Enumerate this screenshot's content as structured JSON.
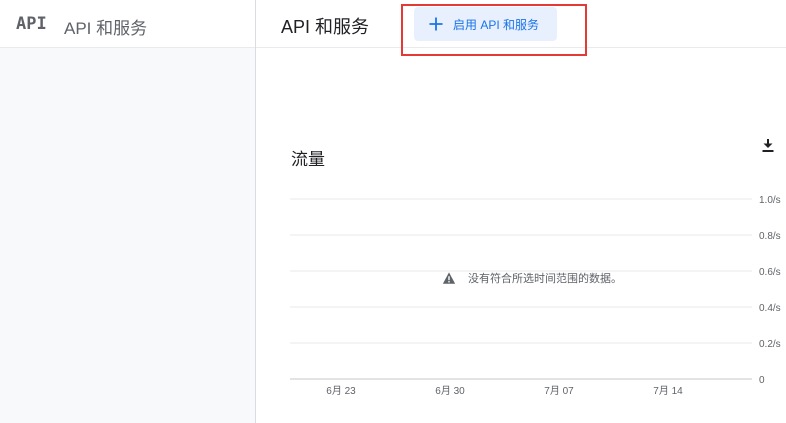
{
  "sidebar": {
    "logo_text": "API",
    "title": "API 和服务"
  },
  "header": {
    "page_title": "API 和服务",
    "enable_button_label": "启用 API 和服务"
  },
  "traffic": {
    "title": "流量",
    "no_data_message": "没有符合所选时间范围的数据。",
    "icons": {
      "download": "download-icon",
      "warning": "warning-icon"
    }
  },
  "colors": {
    "accent": "#1a73e8",
    "button_bg": "#e8f0fe",
    "highlight": "#e53935",
    "grid": "#e8eaed"
  },
  "chart_data": {
    "type": "line",
    "title": "流量",
    "x_tick_labels": [
      "6月 23",
      "6月 30",
      "7月 07",
      "7月 14"
    ],
    "y_tick_labels": [
      "0",
      "0.2/s",
      "0.4/s",
      "0.6/s",
      "0.8/s",
      "1.0/s"
    ],
    "y_ticks": [
      0,
      0.2,
      0.4,
      0.6,
      0.8,
      1.0
    ],
    "ylim": [
      0,
      1.0
    ],
    "series": [],
    "grid": true
  }
}
